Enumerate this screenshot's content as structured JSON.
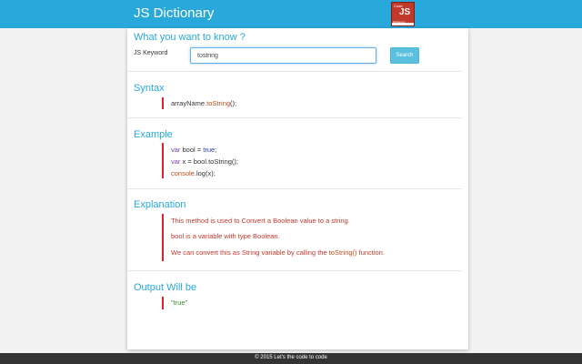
{
  "navbar": {
    "title": "JS Dictionary",
    "logo": {
      "top_text": "Code",
      "main_text": "JS",
      "bottom_text": "Dictionary"
    }
  },
  "search": {
    "heading": "What you want to know ?",
    "label": "JS Keyword",
    "value": "tostring",
    "button_label": "Search"
  },
  "syntax": {
    "heading": "Syntax",
    "parts": {
      "before": "arrayName.",
      "method": "toString",
      "after": "();"
    }
  },
  "example": {
    "heading": "Example",
    "line1": {
      "kw": "var",
      "name": " bool = ",
      "val": "true",
      "end": ";"
    },
    "line2": {
      "kw": "var",
      "rest": " x = bool.toString();"
    },
    "line3": {
      "obj": "console",
      "rest": ".log(x);"
    }
  },
  "explanation": {
    "heading": "Explanation",
    "line1": "This method is used to Convert a Boolean value to a string.",
    "line2": "bool is a variable with type Boolean.",
    "line3_before": "We can convert this as String variable by calling the ",
    "line3_method": "toString()",
    "line3_after": " function."
  },
  "output": {
    "heading": "Output Will be",
    "value": "\"true\""
  },
  "footer": {
    "text": "© 2015 Let's the code to code"
  },
  "colors": {
    "primary": "#29a8dc",
    "accent_bar": "#d9262a",
    "button": "#5bc0de",
    "footer_bg": "#333333"
  }
}
